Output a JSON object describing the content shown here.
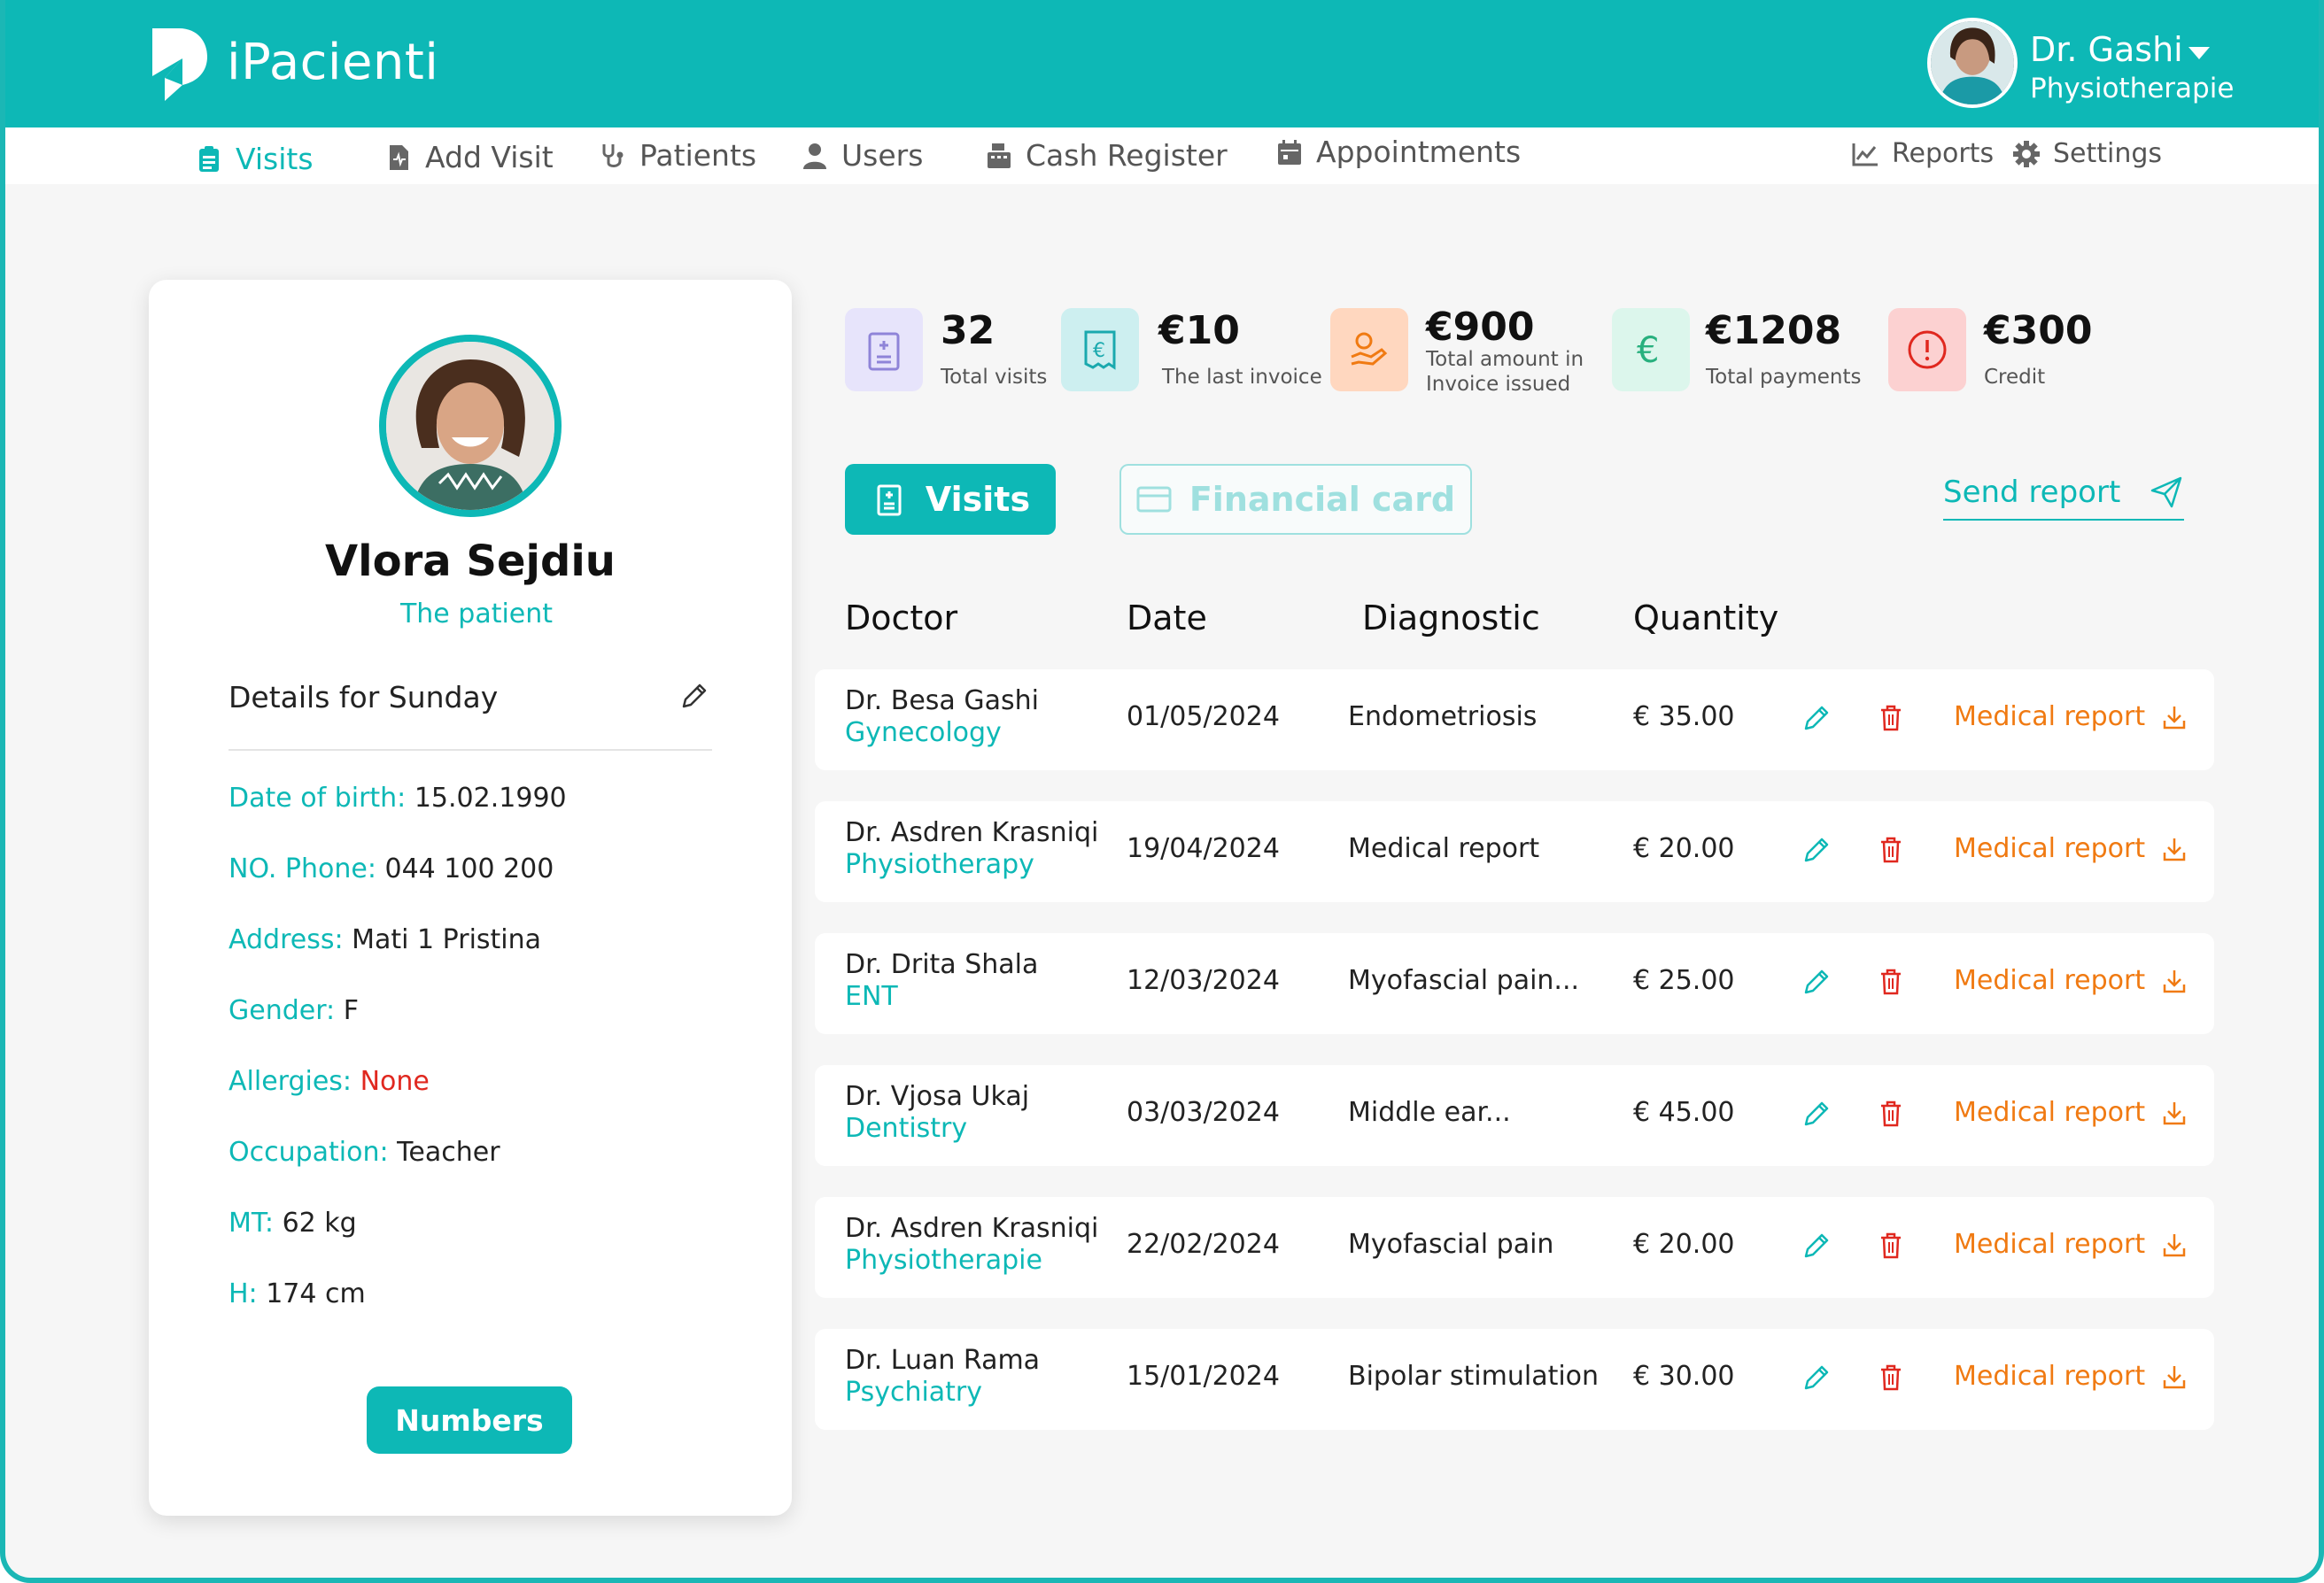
{
  "app": {
    "brand": "iPacienti"
  },
  "user": {
    "name": "Dr. Gashi",
    "role": "Physiotherapie"
  },
  "nav": {
    "visits": "Visits",
    "add_visit": "Add Visit",
    "patients": "Patients",
    "users": "Users",
    "cash_register": "Cash Register",
    "appointments": "Appointments",
    "reports": "Reports",
    "settings": "Settings"
  },
  "patient": {
    "name": "Vlora Sejdiu",
    "role": "The patient",
    "details_title": "Details for Sunday",
    "fields": {
      "dob_label": "Date of birth:",
      "dob": "15.02.1990",
      "phone_label": "NO. Phone:",
      "phone": "044 100 200",
      "address_label": "Address:",
      "address": "Mati 1 Pristina",
      "gender_label": "Gender:",
      "gender": "F",
      "allergies_label": "Allergies:",
      "allergies": "None",
      "occupation_label": "Occupation:",
      "occupation": "Teacher",
      "mt_label": "MT:",
      "mt": "62 kg",
      "h_label": "H:",
      "h": "174 cm"
    },
    "numbers_button": "Numbers"
  },
  "stats": {
    "total_visits_value": "32",
    "total_visits_label": "Total visits",
    "last_invoice_value": "€10",
    "last_invoice_label": "The last invoice",
    "invoice_issued_value": "€900",
    "invoice_issued_label_1": "Total amount in",
    "invoice_issued_label_2": "Invoice issued",
    "total_payments_value": "€1208",
    "total_payments_label": "Total payments",
    "credit_value": "€300",
    "credit_label": "Credit"
  },
  "tabs": {
    "visits": "Visits",
    "financial_card": "Financial card",
    "send_report": "Send report"
  },
  "table": {
    "headers": {
      "doctor": "Doctor",
      "date": "Date",
      "diagnostic": "Diagnostic",
      "quantity": "Quantity"
    },
    "rows": [
      {
        "doctor": "Dr. Besa Gashi",
        "specialty": "Gynecology",
        "date": "01/05/2024",
        "diagnostic": "Endometriosis",
        "quantity": "€ 35.00",
        "report": "Medical report"
      },
      {
        "doctor": "Dr. Asdren Krasniqi",
        "specialty": "Physiotherapy",
        "date": "19/04/2024",
        "diagnostic": "Medical report",
        "quantity": "€ 20.00",
        "report": "Medical report"
      },
      {
        "doctor": "Dr. Drita Shala",
        "specialty": "ENT",
        "date": "12/03/2024",
        "diagnostic": "Myofascial pain...",
        "quantity": "€ 25.00",
        "report": "Medical report"
      },
      {
        "doctor": "Dr. Vjosa Ukaj",
        "specialty": "Dentistry",
        "date": "03/03/2024",
        "diagnostic": "Middle ear...",
        "quantity": "€ 45.00",
        "report": "Medical report"
      },
      {
        "doctor": "Dr. Asdren Krasniqi",
        "specialty": "Physiotherapie",
        "date": "22/02/2024",
        "diagnostic": "Myofascial pain",
        "quantity": "€ 20.00",
        "report": "Medical report"
      },
      {
        "doctor": "Dr. Luan Rama",
        "specialty": "Psychiatry",
        "date": "15/01/2024",
        "diagnostic": "Bipolar stimulation",
        "quantity": "€ 30.00",
        "report": "Medical report"
      }
    ]
  },
  "colors": {
    "accent": "#0db8b6",
    "warning": "#f07a12",
    "danger": "#e0281f"
  },
  "icons": [
    "logo-icon",
    "clipboard-icon",
    "add-file-icon",
    "stethoscope-icon",
    "users-icon",
    "cash-register-icon",
    "calendar-icon",
    "chart-icon",
    "gear-icon",
    "edit-icon",
    "trash-icon",
    "download-icon",
    "send-icon",
    "card-icon",
    "hospital-icon",
    "invoice-icon",
    "hand-money-icon",
    "euro-icon",
    "alert-icon",
    "caret-down-icon"
  ]
}
